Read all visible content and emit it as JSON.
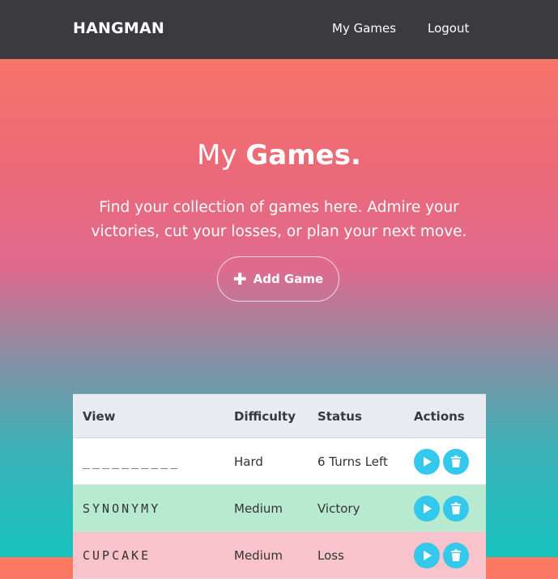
{
  "nav": {
    "brand": "HANGMAN",
    "my_games": "My Games",
    "logout": "Logout"
  },
  "hero": {
    "title_light": "My",
    "title_bold": "Games.",
    "subtitle": "Find your collection of games here. Admire your victories, cut your losses, or plan your next move.",
    "add_button": "Add Game"
  },
  "table": {
    "headers": [
      "View",
      "Difficulty",
      "Status",
      "Actions"
    ],
    "rows": [
      {
        "view": "__________",
        "difficulty": "Hard",
        "status": "6 Turns Left",
        "result": "in-progress"
      },
      {
        "view": "SYNONYMY",
        "difficulty": "Medium",
        "status": "Victory",
        "result": "victory"
      },
      {
        "view": "CUPCAKE",
        "difficulty": "Medium",
        "status": "Loss",
        "result": "loss"
      }
    ]
  },
  "colors": {
    "navbar": "#3b3b3f",
    "action_button": "#34c8ec",
    "victory_row": "#b8ead0",
    "loss_row": "#f9c3cb",
    "gradient_top": "#fc7a62",
    "gradient_bottom": "#16c2be"
  },
  "icons": {
    "add": "plus-icon",
    "play": "play-icon",
    "delete": "trash-icon"
  }
}
